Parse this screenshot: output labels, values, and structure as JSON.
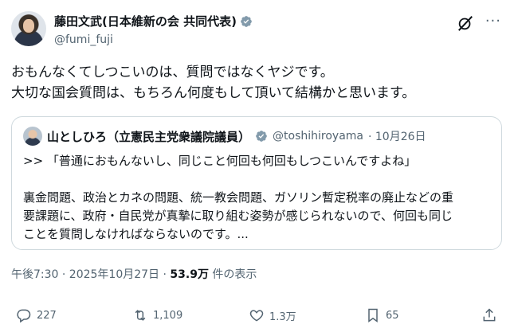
{
  "author": {
    "display_name": "藤田文武(日本維新の会 共同代表)",
    "handle": "@fumi_fuji"
  },
  "post": {
    "lines": [
      "おもんなくてしつこいのは、質問ではなくヤジです。",
      "大切な国会質問は、もちろん何度もして頂いて結構かと思います。"
    ]
  },
  "quote": {
    "display_name": "山としひろ（立憲民主党衆議院議員）",
    "handle": "@toshihiroyama",
    "date": "· 10月26日",
    "line1": ">> 「普通におもんないし、同じこと何回も何回もしつこいんですよね」",
    "line2": "裏金問題、政治とカネの問題、統一教会問題、ガソリン暫定税率の廃止などの重",
    "line3": "要課題に、政府・自民党が真摯に取り組む姿勢が感じられないので、何回も同じ",
    "line4": "ことを質問しなければならないのです。..."
  },
  "meta": {
    "time": "午後7:30 · 2025年10月27日 · ",
    "views": "53.9万",
    "views_suffix": " 件の表示"
  },
  "actions": {
    "replies": "227",
    "reposts": "1,109",
    "likes": "1.3万",
    "bookmarks": "65"
  },
  "icons": {
    "verified": "verified-badge-icon",
    "grok": "grok-icon",
    "more": "more-icon",
    "reply": "reply-icon",
    "repost": "repost-icon",
    "like": "heart-icon",
    "bookmark": "bookmark-icon",
    "share": "share-icon"
  },
  "colors": {
    "verified": "#829aab",
    "text": "#0f1419",
    "muted": "#536471",
    "border": "#cfd9de"
  }
}
